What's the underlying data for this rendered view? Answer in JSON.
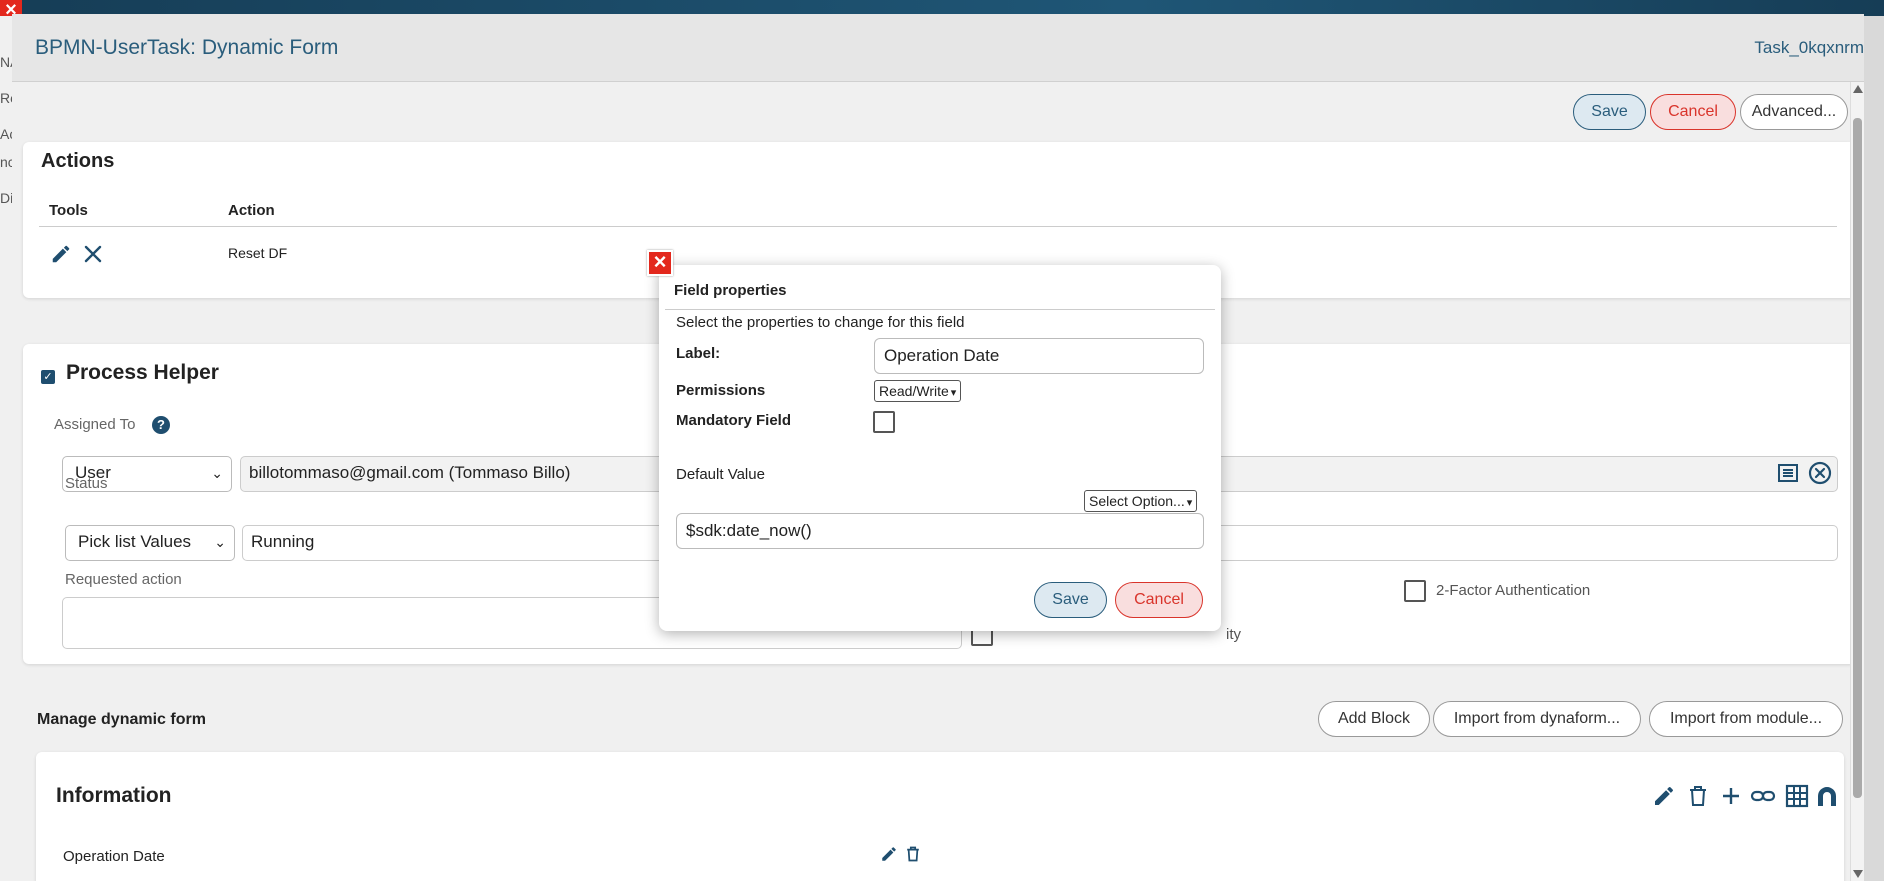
{
  "modal": {
    "title": "BPMN-UserTask: Dynamic Form",
    "task_id": "Task_0kqxnrm",
    "save_label": "Save",
    "cancel_label": "Cancel",
    "advanced_label": "Advanced..."
  },
  "background_strip": {
    "fragments": [
      "NA",
      "Re",
      "Ac",
      "nc",
      "Di"
    ]
  },
  "actions": {
    "title": "Actions",
    "columns": [
      "Tools",
      "Action"
    ],
    "rows": [
      {
        "action": "Reset DF"
      }
    ]
  },
  "process_helper": {
    "title": "Process Helper",
    "assigned_to": {
      "label": "Assigned To",
      "type": "User",
      "value": "billotommaso@gmail.com (Tommaso Billo)"
    },
    "status": {
      "label": "Status",
      "type": "Pick list Values",
      "value": "Running"
    },
    "requested_action": {
      "label": "Requested action",
      "value": ""
    },
    "two_factor_label": "2-Factor Authentication",
    "partial_label": "ity"
  },
  "manage": {
    "title": "Manage dynamic form",
    "add_block_label": "Add Block",
    "import_dynaform_label": "Import from dynaform...",
    "import_module_label": "Import from module..."
  },
  "information_block": {
    "title": "Information",
    "fields": [
      {
        "label": "Operation Date"
      }
    ]
  },
  "field_properties": {
    "title": "Field properties",
    "subtitle": "Select the properties to change for this field",
    "label_label": "Label:",
    "label_value": "Operation Date",
    "permissions_label": "Permissions",
    "permissions_value": "Read/Write",
    "mandatory_label": "Mandatory Field",
    "mandatory_checked": false,
    "default_value_label": "Default Value",
    "select_option_label": "Select Option...",
    "default_value": "$sdk:date_now()",
    "save_label": "Save",
    "cancel_label": "Cancel"
  },
  "colors": {
    "primary": "#2a5d7c",
    "danger": "#d9342b",
    "close_red": "#e3281d",
    "icon_dark": "#1f4e6f"
  }
}
